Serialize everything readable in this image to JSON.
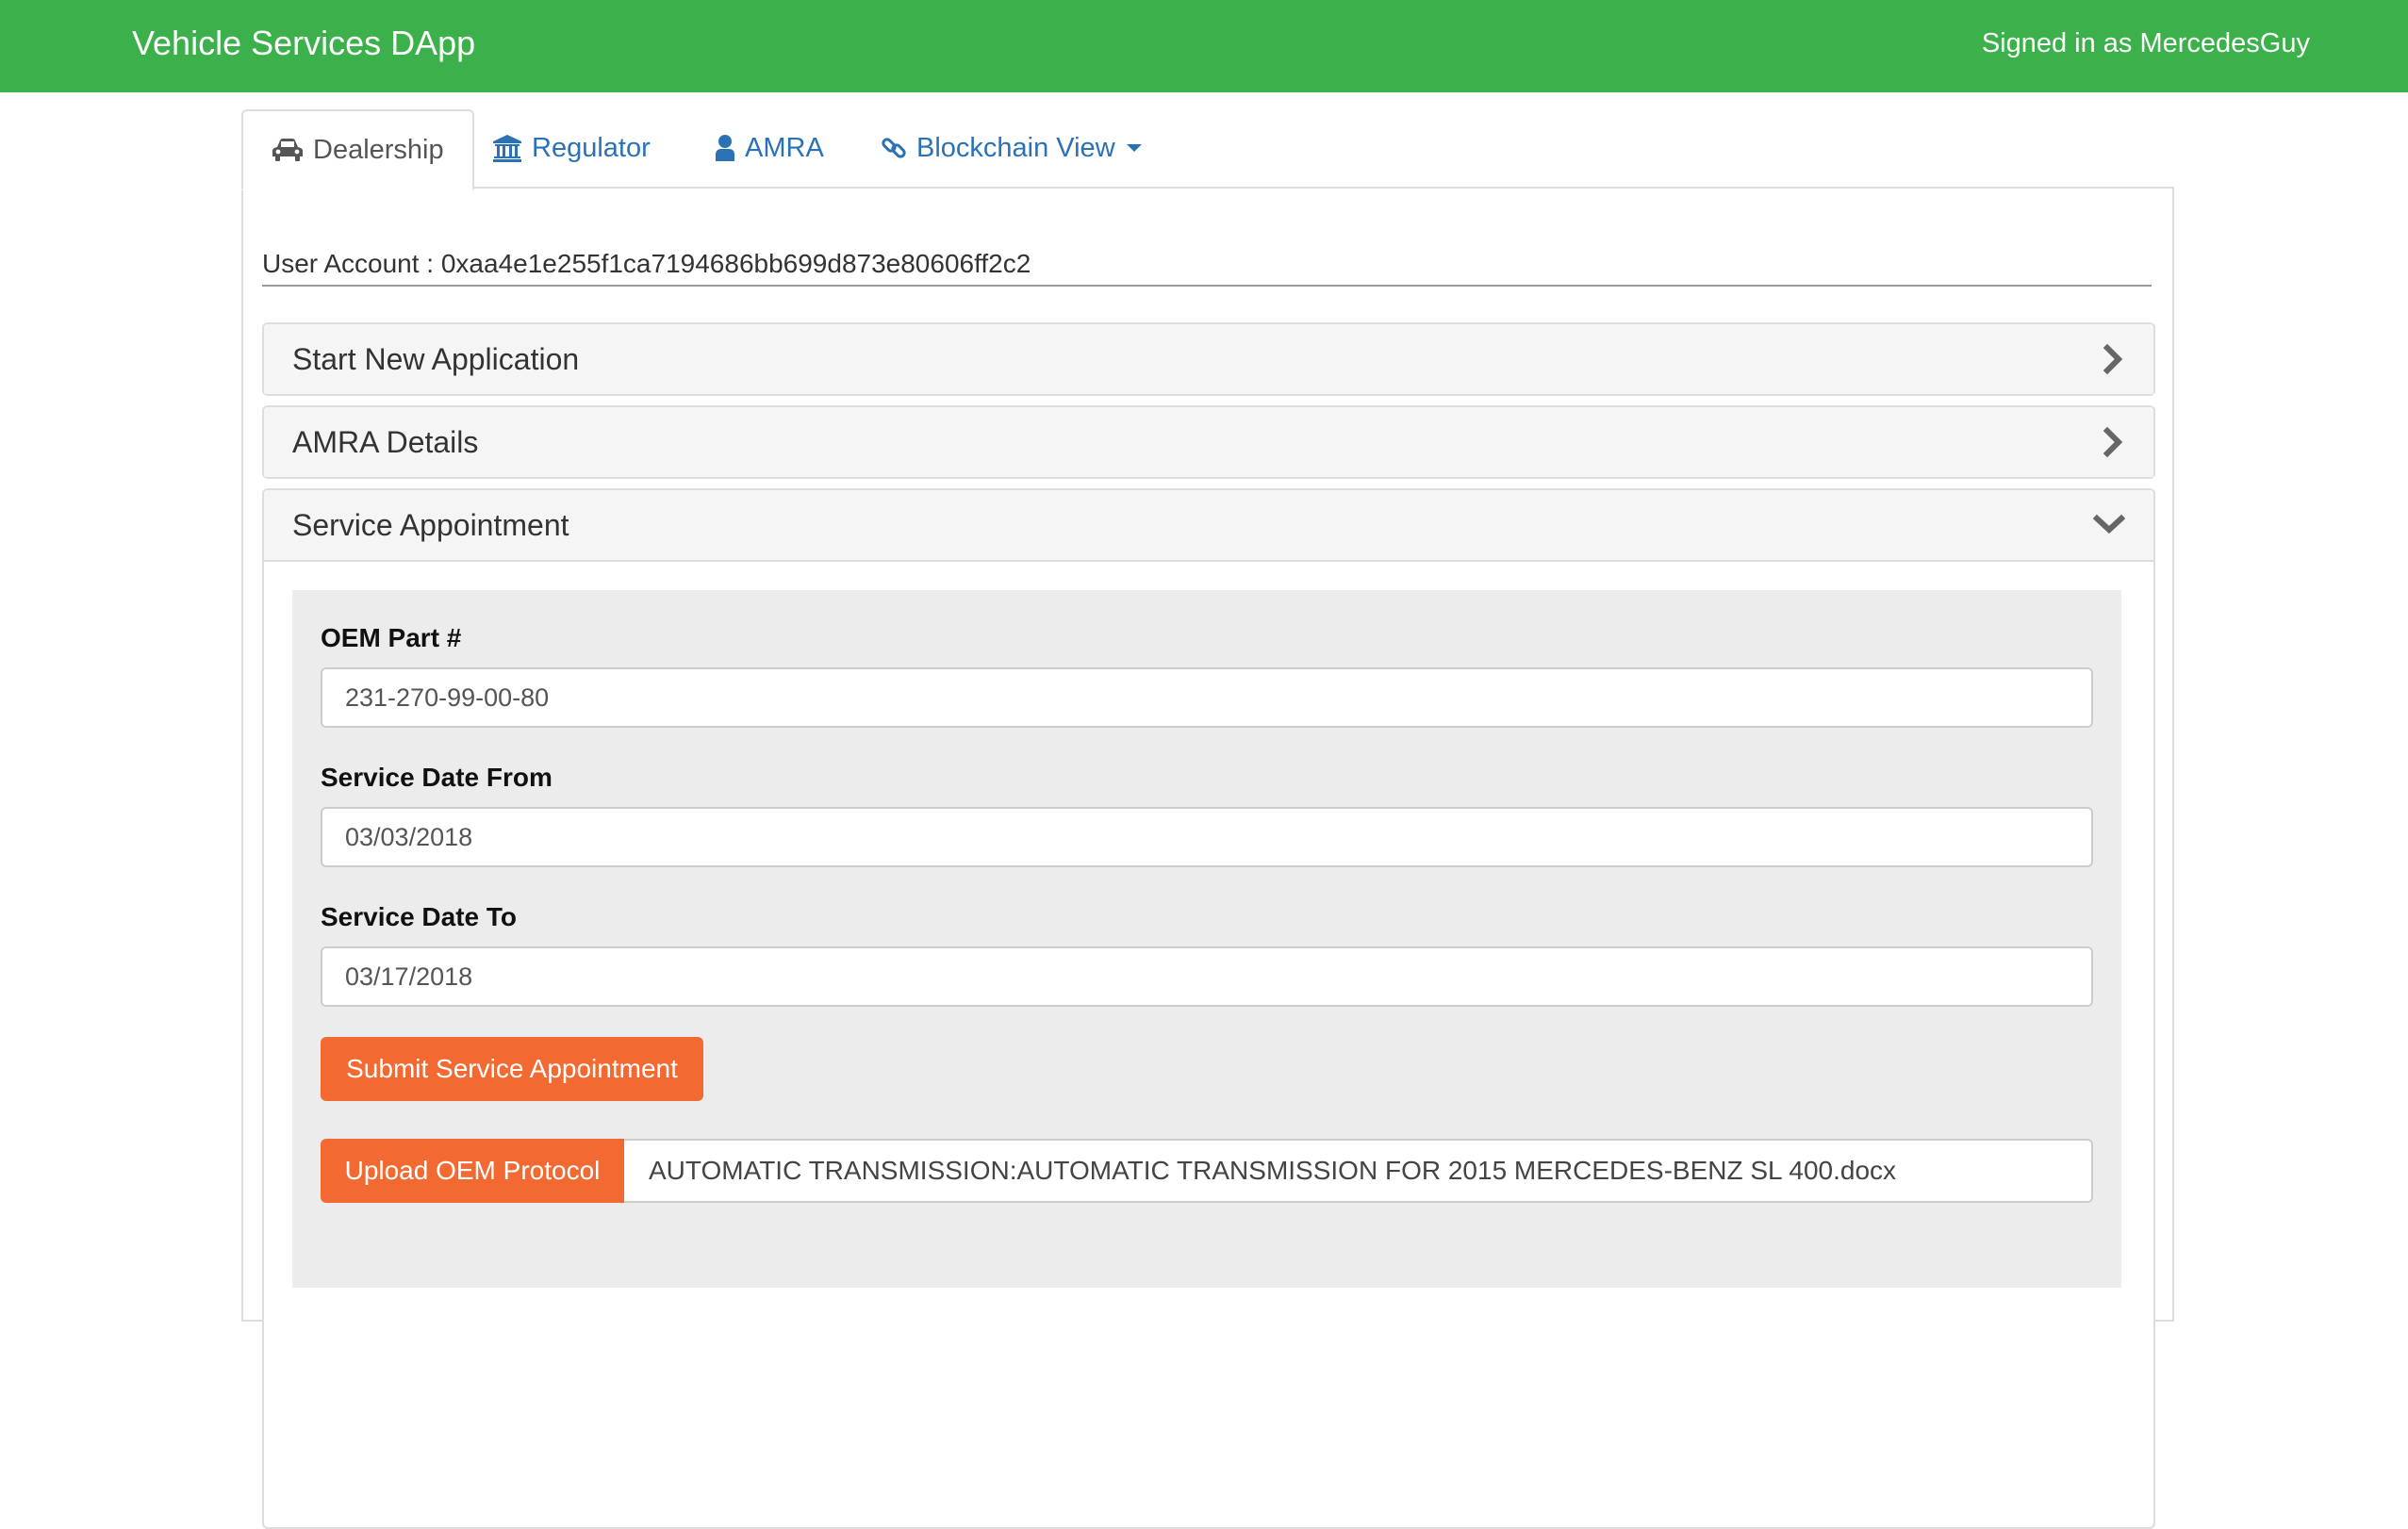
{
  "navbar": {
    "brand": "Vehicle Services DApp",
    "signed_in": "Signed in as MercedesGuy",
    "background_color": "#3cb04a"
  },
  "tabs": [
    {
      "label": "Dealership",
      "icon": "car-icon",
      "active": true
    },
    {
      "label": "Regulator",
      "icon": "bank-icon",
      "active": false
    },
    {
      "label": "AMRA",
      "icon": "user-icon",
      "active": false
    },
    {
      "label": "Blockchain View",
      "icon": "link-icon",
      "active": false,
      "dropdown": true
    }
  ],
  "account": {
    "text": "User Account : 0xaa4e1e255f1ca7194686bb699d873e80606ff2c2"
  },
  "panels": [
    {
      "title": "Start New Application",
      "state": "collapsed",
      "icon": "chevron-right-icon"
    },
    {
      "title": "AMRA Details",
      "state": "collapsed",
      "icon": "chevron-right-icon"
    },
    {
      "title": "Service Appointment",
      "state": "expanded",
      "icon": "chevron-down-icon"
    }
  ],
  "form": {
    "oem_part_label": "OEM Part #",
    "oem_part_value": "231-270-99-00-80",
    "date_from_label": "Service Date From",
    "date_from_value": "03/03/2018",
    "date_to_label": "Service Date To",
    "date_to_value": "03/17/2018",
    "submit_label": "Submit Service Appointment",
    "upload_label": "Upload OEM Protocol",
    "upload_filename": "AUTOMATIC TRANSMISSION:AUTOMATIC TRANSMISSION FOR 2015 MERCEDES-BENZ SL 400.docx"
  },
  "colors": {
    "accent_orange": "#f26a32",
    "link_blue": "#2a72b5"
  }
}
